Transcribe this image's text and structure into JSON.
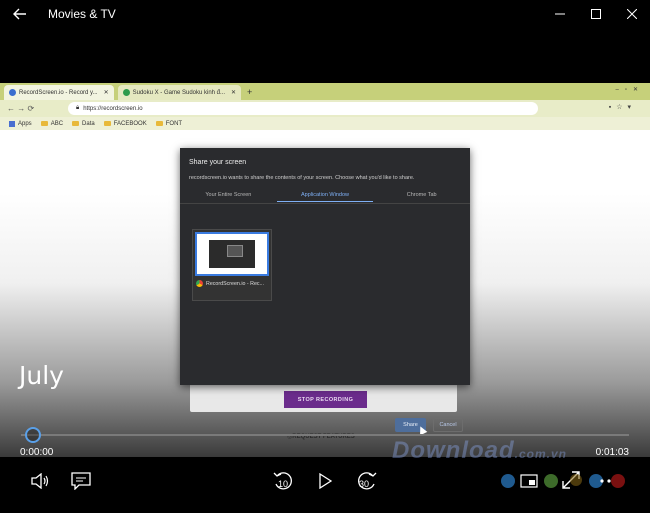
{
  "app": {
    "title": "Movies & TV",
    "back_icon": "back-arrow-icon"
  },
  "window_controls": [
    "minimize-icon",
    "maximize-icon",
    "close-icon"
  ],
  "recording": {
    "chrome": {
      "tabs": [
        {
          "label": "RecordScreen.io - Record y..."
        },
        {
          "label": "Sudoku X - Game Sudoku kinh đ..."
        }
      ],
      "address": "https://recordscreen.io",
      "bookmarks": [
        "Apps",
        "ABC",
        "Data",
        "FACEBOOK",
        "FONT"
      ]
    },
    "share_dialog": {
      "title": "Share your screen",
      "subtitle": "recordscreen.io wants to share the contents of your screen. Choose what you'd like to share.",
      "tabs": [
        {
          "label": "Your Entire Screen"
        },
        {
          "label": "Application Window"
        },
        {
          "label": "Chrome Tab"
        }
      ],
      "active_tab": "Application Window",
      "window_item": "RecordScreen.io - Rec...",
      "share_label": "Share",
      "cancel_label": "Cancel"
    },
    "page": {
      "stop_label": "STOP RECORDING",
      "request_label": "REQUEST FEATURES"
    }
  },
  "video_title": "July",
  "watermark": {
    "main": "Download",
    "suffix": ".com.vn"
  },
  "playback": {
    "current_time": "0:00:00",
    "total_time": "0:01:03",
    "progress": 0.0,
    "skip_back_seconds": "10",
    "skip_forward_seconds": "30"
  },
  "colors": {
    "accent": "#5aa0e8",
    "dots": [
      "#1f5a8f",
      "#3d6b2a",
      "#8a6a16",
      "#1f5a8f",
      "#7a1010"
    ]
  }
}
